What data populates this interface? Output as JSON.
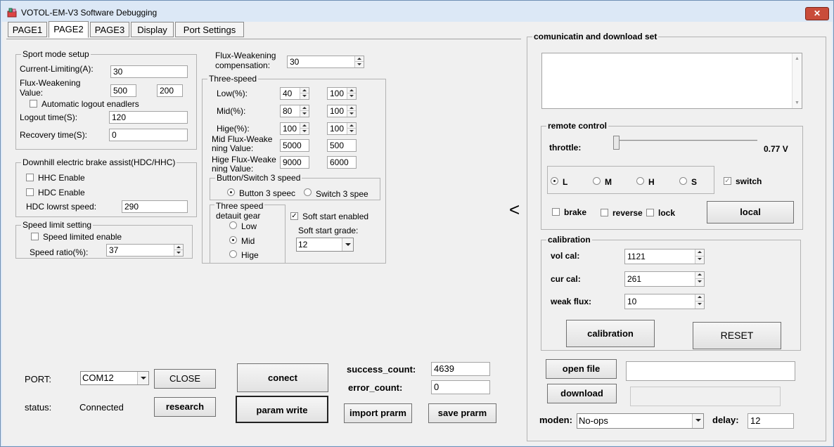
{
  "window": {
    "title": "VOTOL-EM-V3 Software Debugging",
    "close": "✕"
  },
  "tabs": [
    "PAGE1",
    "PAGE2",
    "PAGE3",
    "Display",
    "Port Settings"
  ],
  "sport": {
    "legend": "Sport mode setup",
    "current_label": "Current-Limiting(A):",
    "current_value": "30",
    "flux_label_1": "Flux-Weakening",
    "flux_label_2": "Value:",
    "flux_value_1": "500",
    "flux_value_2": "200",
    "auto_logout_label": "Automatic logout enadlers",
    "logout_label": "Logout time(S):",
    "logout_value": "120",
    "recovery_label": "Recovery time(S):",
    "recovery_value": "0"
  },
  "downhill": {
    "legend": "Downhill electric brake assist(HDC/HHC)",
    "hhc_label": "HHC Enable",
    "hdc_label": "HDC Enable",
    "lowest_label": "HDC lowrst speed:",
    "lowest_value": "290"
  },
  "speedlimit": {
    "legend": "Speed limit setting",
    "enable_label": "Speed limited enable",
    "ratio_label": "Speed ratio(%):",
    "ratio_value": "37"
  },
  "fluxcomp": {
    "label_1": "Flux-Weakening",
    "label_2": "compensation:",
    "value": "30"
  },
  "threespeed": {
    "legend": "Three-speed",
    "low_label": "Low(%):",
    "low_v1": "40",
    "low_v2": "100",
    "mid_label": "Mid(%):",
    "mid_v1": "80",
    "mid_v2": "100",
    "hige_label": "Hige(%):",
    "hige_v1": "100",
    "hige_v2": "100",
    "midflux_label_1": "Mid Flux-Weake",
    "midflux_label_2": "ning Value:",
    "midflux_v1": "5000",
    "midflux_v2": "500",
    "higeflux_label_1": "Hige Flux-Weake",
    "higeflux_label_2": "ning Value:",
    "higeflux_v1": "9000",
    "higeflux_v2": "6000",
    "switch_legend": "Button/Switch 3 speed",
    "button3_label": "Button 3 speec",
    "switch3_label": "Switch 3 spee",
    "default_legend_1": "Three speed",
    "default_legend_2": "detauit gear",
    "gear_low": "Low",
    "gear_mid": "Mid",
    "gear_hige": "Hige",
    "softstart_label": "Soft start enabled",
    "softgrade_label": "Soft start grade:",
    "softgrade_value": "12"
  },
  "bottom": {
    "port_label": "PORT:",
    "port_value": "COM12",
    "close_btn": "CLOSE",
    "status_label": "status:",
    "status_value": "Connected",
    "research_btn": "research",
    "connect_btn": "conect",
    "paramwrite_btn": "param write",
    "success_label": "success_count:",
    "success_value": "4639",
    "error_label": "error_count:",
    "error_value": "0",
    "import_btn": "import prarm",
    "save_btn": "save prarm"
  },
  "collapse_arrow": "<",
  "comm": {
    "legend": "comunicatin and download set",
    "remote_legend": "remote control",
    "throttle_label": "throttle:",
    "throttle_value": "0.77  V",
    "throttle_level": 0.0,
    "mode_L": "L",
    "mode_M": "M",
    "mode_H": "H",
    "mode_S": "S",
    "switch_label": "switch",
    "brake_label": "brake",
    "reverse_label": "reverse",
    "lock_label": "lock",
    "local_btn": "local",
    "calib_legend": "calibration",
    "volcal_label": "vol cal:",
    "volcal_value": "1121",
    "curcal_label": "cur cal:",
    "curcal_value": "261",
    "weakflux_label": "weak flux:",
    "weakflux_value": "10",
    "calibration_btn": "calibration",
    "reset_btn": "RESET",
    "openfile_btn": "open file",
    "download_btn": "download",
    "moden_label": "moden:",
    "moden_value": "No-ops",
    "delay_label": "delay:",
    "delay_value": "12"
  }
}
